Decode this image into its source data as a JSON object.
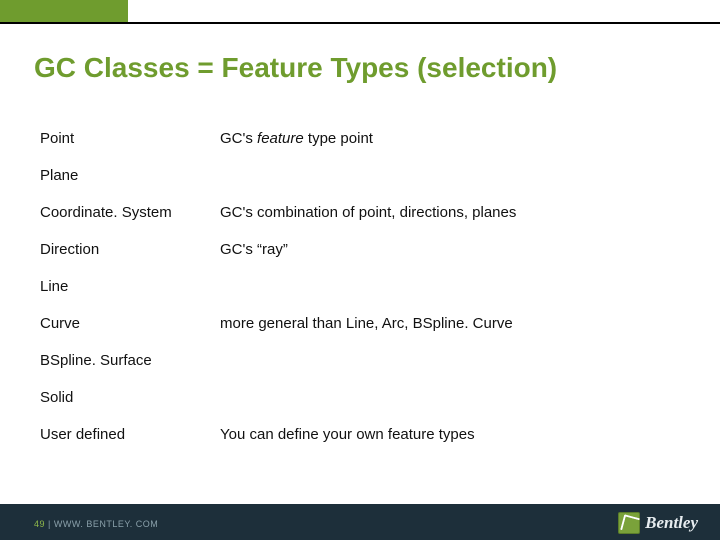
{
  "title": "GC Classes = Feature Types (selection)",
  "rows": [
    {
      "term": "Point",
      "desc_pre": "GC's ",
      "desc_ital": "feature",
      "desc_post": " type point"
    },
    {
      "term": "Plane",
      "desc_pre": "",
      "desc_ital": "",
      "desc_post": ""
    },
    {
      "term": "Coordinate. System",
      "desc_pre": "GC's combination of point, directions, planes",
      "desc_ital": "",
      "desc_post": ""
    },
    {
      "term": "Direction",
      "desc_pre": "GC's “ray”",
      "desc_ital": "",
      "desc_post": ""
    },
    {
      "term": "Line",
      "desc_pre": "",
      "desc_ital": "",
      "desc_post": ""
    },
    {
      "term": "Curve",
      "desc_pre": "more general than Line, Arc, BSpline. Curve",
      "desc_ital": "",
      "desc_post": ""
    },
    {
      "term": "BSpline. Surface",
      "desc_pre": "",
      "desc_ital": "",
      "desc_post": ""
    },
    {
      "term": "Solid",
      "desc_pre": "",
      "desc_ital": "",
      "desc_post": ""
    },
    {
      "term": "User defined",
      "desc_pre": "You can define your own feature types",
      "desc_ital": "",
      "desc_post": ""
    }
  ],
  "footer": {
    "page": "49",
    "sep": " | ",
    "url": "WWW. BENTLEY. COM"
  },
  "logo": {
    "text": "Bentley"
  }
}
